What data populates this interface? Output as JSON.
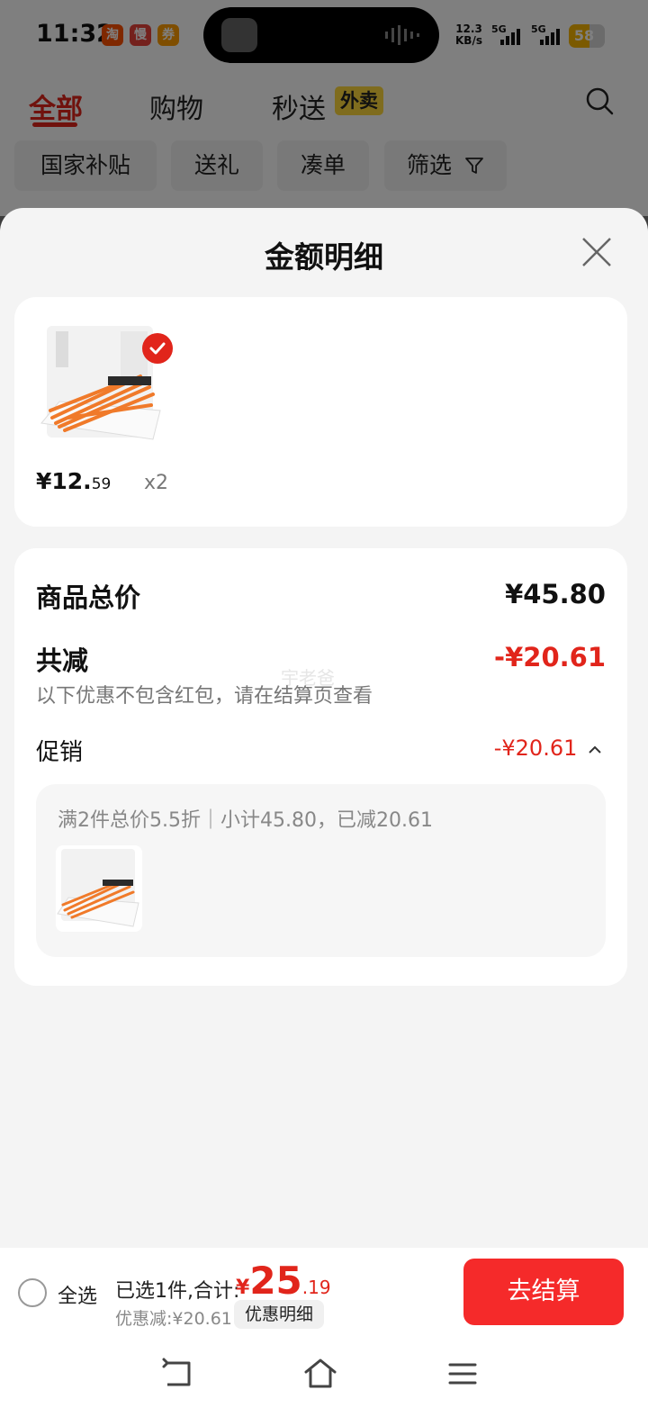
{
  "status_bar": {
    "time": "11:32",
    "app_icons": [
      {
        "name": "taobao-icon",
        "glyph": "淘",
        "color": "#ff5000"
      },
      {
        "name": "slow-app-icon",
        "glyph": "慢",
        "color": "#e8423a"
      },
      {
        "name": "coupon-app-icon",
        "glyph": "券",
        "color": "#ff9d00"
      }
    ],
    "speed_value": "12.3",
    "speed_unit": "KB/s",
    "network_1": "5G",
    "network_2": "5G",
    "battery": "58",
    "battery_level": 0.58
  },
  "top_tabs": {
    "all": "全部",
    "shopping": "购物",
    "express": "秒送",
    "express_badge": "外卖"
  },
  "filter_chips": {
    "subsidy": "国家补贴",
    "gift": "送礼",
    "bundle": "凑单",
    "filter": "筛选"
  },
  "sheet": {
    "title": "金额明细",
    "product": {
      "price_int": "¥12.",
      "price_dec": "59",
      "quantity": "x2"
    },
    "summary": {
      "goods_total_label": "商品总价",
      "goods_total_value": "¥45.80",
      "reduce_label": "共减",
      "reduce_value": "-¥20.61",
      "reduce_note": "以下优惠不包含红包，请在结算页查看",
      "watermark": "宇老爸",
      "promo_label": "促销",
      "promo_value": "-¥20.61",
      "promo_rule": "满2件总价5.5折｜小计45.80，已减20.61"
    }
  },
  "checkout_bar": {
    "select_all": "全选",
    "selected_text": "已选1件,合计:",
    "currency": "¥",
    "total_int": "25",
    "total_dec": ".19",
    "discount_text": "优惠减:¥20.61",
    "detail_button": "优惠明细",
    "pay_button": "去结算"
  },
  "colors": {
    "accent": "#e1251b",
    "pay_button": "#f52a2a"
  }
}
